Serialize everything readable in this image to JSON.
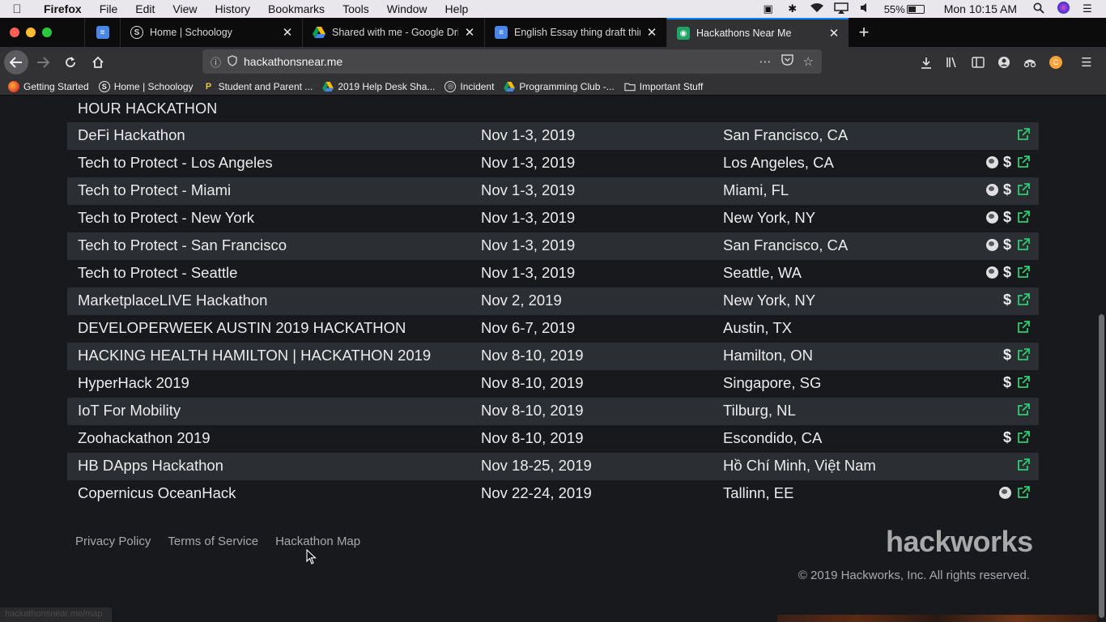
{
  "menubar": {
    "app_name": "Firefox",
    "menus": [
      "File",
      "Edit",
      "View",
      "History",
      "Bookmarks",
      "Tools",
      "Window",
      "Help"
    ],
    "battery_pct": "55%",
    "clock": "Mon 10:15 AM",
    "battery_level": 0.55
  },
  "tabs": [
    {
      "label": "Home | Schoology",
      "icon": "schoology-icon",
      "color": "#ffffff"
    },
    {
      "label": "Shared with me - Google Drive",
      "icon": "google-drive-icon",
      "color": "#ffffff"
    },
    {
      "label": "English Essay thing draft thing",
      "icon": "google-docs-icon",
      "color": "#ffffff"
    },
    {
      "label": "Hackathons Near Me",
      "icon": "map-pin-icon",
      "color": "#ffffff"
    }
  ],
  "navbar": {
    "url": "hackathonsnear.me"
  },
  "bookmarks": [
    {
      "label": "Getting Started",
      "icon": "firefox-icon"
    },
    {
      "label": "Home | Schoology",
      "icon": "schoology-icon"
    },
    {
      "label": "Student and Parent ...",
      "icon": "parent-portal-icon"
    },
    {
      "label": "2019 Help Desk Sha...",
      "icon": "google-drive-icon"
    },
    {
      "label": "Incident",
      "icon": "globe-icon"
    },
    {
      "label": "Programming Club -...",
      "icon": "google-drive-icon"
    },
    {
      "label": "Important Stuff",
      "icon": "folder-icon"
    }
  ],
  "page": {
    "prev_tail": "HOUR HACKATHON",
    "events": [
      {
        "name": "DeFi Hackathon",
        "date": "Nov 1-3, 2019",
        "location": "San Francisco, CA",
        "online": false,
        "prize": false
      },
      {
        "name": "Tech to Protect - Los Angeles",
        "date": "Nov 1-3, 2019",
        "location": "Los Angeles, CA",
        "online": true,
        "prize": true
      },
      {
        "name": "Tech to Protect - Miami",
        "date": "Nov 1-3, 2019",
        "location": "Miami, FL",
        "online": true,
        "prize": true
      },
      {
        "name": "Tech to Protect - New York",
        "date": "Nov 1-3, 2019",
        "location": "New York, NY",
        "online": true,
        "prize": true
      },
      {
        "name": "Tech to Protect - San Francisco",
        "date": "Nov 1-3, 2019",
        "location": "San Francisco, CA",
        "online": true,
        "prize": true
      },
      {
        "name": "Tech to Protect - Seattle",
        "date": "Nov 1-3, 2019",
        "location": "Seattle, WA",
        "online": true,
        "prize": true
      },
      {
        "name": "MarketplaceLIVE Hackathon",
        "date": "Nov 2, 2019",
        "location": "New York, NY",
        "online": false,
        "prize": true
      },
      {
        "name": "DEVELOPERWEEK AUSTIN 2019 HACKATHON",
        "date": "Nov 6-7, 2019",
        "location": "Austin, TX",
        "online": false,
        "prize": false
      },
      {
        "name": "HACKING HEALTH HAMILTON | HACKATHON 2019",
        "date": "Nov 8-10, 2019",
        "location": "Hamilton, ON",
        "online": false,
        "prize": true
      },
      {
        "name": "HyperHack 2019",
        "date": "Nov 8-10, 2019",
        "location": "Singapore, SG",
        "online": false,
        "prize": true
      },
      {
        "name": "IoT For Mobility",
        "date": "Nov 8-10, 2019",
        "location": "Tilburg, NL",
        "online": false,
        "prize": false
      },
      {
        "name": "Zoohackathon 2019",
        "date": "Nov 8-10, 2019",
        "location": "Escondido, CA",
        "online": false,
        "prize": true
      },
      {
        "name": "HB DApps Hackathon",
        "date": "Nov 18-25, 2019",
        "location": "Hồ Chí Minh, Việt Nam",
        "online": false,
        "prize": false
      },
      {
        "name": "Copernicus OceanHack",
        "date": "Nov 22-24, 2019",
        "location": "Tallinn, EE",
        "online": true,
        "prize": false
      }
    ],
    "prize_symbol": "$"
  },
  "footer": {
    "links": [
      "Privacy Policy",
      "Terms of Service",
      "Hackathon Map"
    ],
    "logo": "hackworks",
    "copyright": "© 2019 Hackworks, Inc. All rights reserved."
  },
  "status_url": "hackathonsnear.me/map",
  "colors": {
    "link_green": "#2ecc71",
    "row_alt": "#2b2e33",
    "page_bg": "#17191c",
    "active_tab_accent": "#0a84ff"
  }
}
